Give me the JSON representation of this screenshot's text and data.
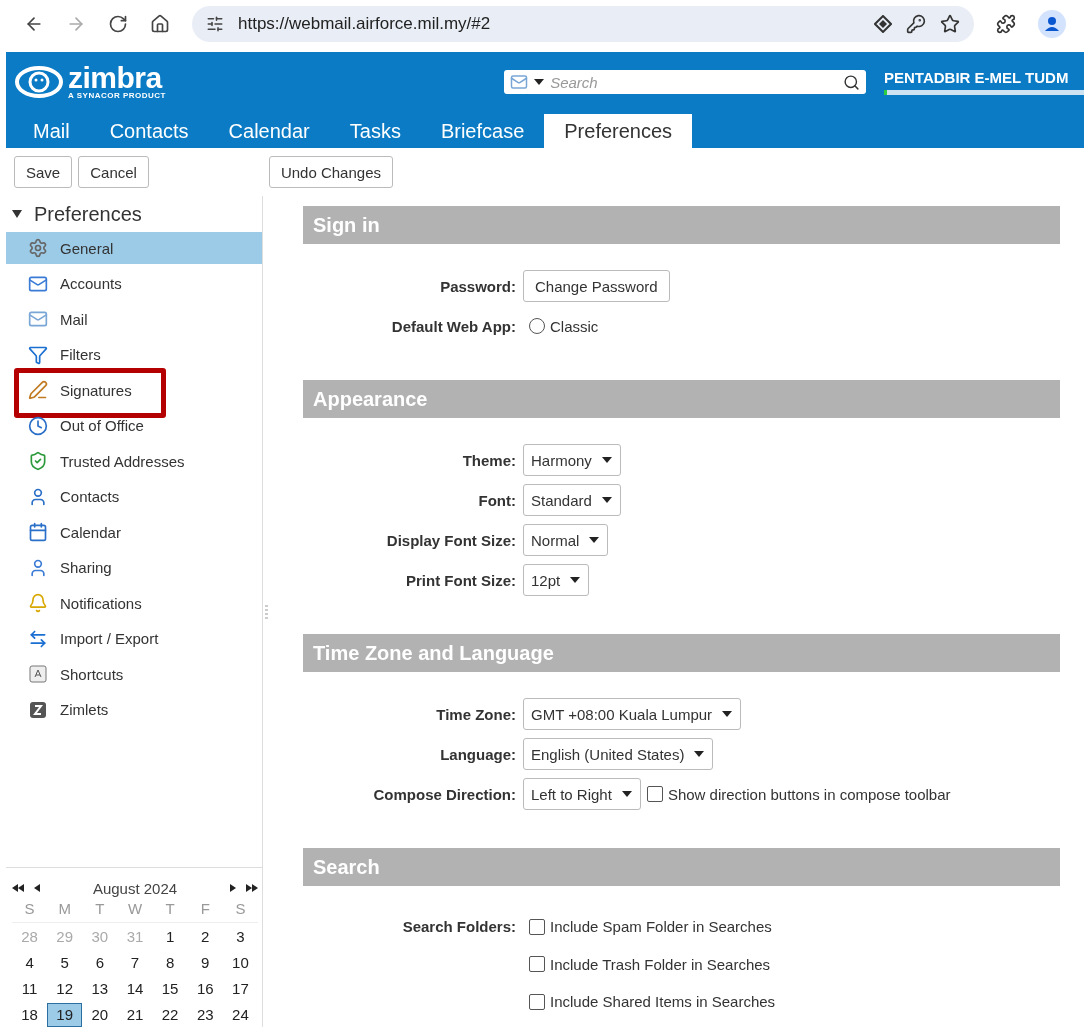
{
  "browser": {
    "url": "https://webmail.airforce.mil.my/#2"
  },
  "header": {
    "logo": "zimbra",
    "logo_tagline": "A SYNACOR PRODUCT",
    "search_placeholder": "Search",
    "user": "PENTADBIR E-MEL TUDM",
    "quota": {
      "level": 0.01
    }
  },
  "app_tabs": [
    {
      "label": "Mail",
      "selected": false
    },
    {
      "label": "Contacts",
      "selected": false
    },
    {
      "label": "Calendar",
      "selected": false
    },
    {
      "label": "Tasks",
      "selected": false
    },
    {
      "label": "Briefcase",
      "selected": false
    },
    {
      "label": "Preferences",
      "selected": true
    }
  ],
  "toolbar": {
    "buttons": [
      "Save",
      "Cancel"
    ],
    "undo": "Undo Changes"
  },
  "sidebar": {
    "title": "Preferences",
    "expanded": true,
    "items": [
      {
        "label": "General",
        "kind": "gear",
        "selected": true,
        "highlighted": false
      },
      {
        "label": "Accounts",
        "kind": "accounts",
        "selected": false,
        "highlighted": false
      },
      {
        "label": "Mail",
        "kind": "mail",
        "selected": false,
        "highlighted": false
      },
      {
        "label": "Filters",
        "kind": "filter",
        "selected": false,
        "highlighted": false
      },
      {
        "label": "Signatures",
        "kind": "signature",
        "selected": false,
        "highlighted": true
      },
      {
        "label": "Out of Office",
        "kind": "clock",
        "selected": false,
        "highlighted": false
      },
      {
        "label": "Trusted Addresses",
        "kind": "shield",
        "selected": false,
        "highlighted": false
      },
      {
        "label": "Contacts",
        "kind": "person",
        "selected": false,
        "highlighted": false
      },
      {
        "label": "Calendar",
        "kind": "calendar",
        "selected": false,
        "highlighted": false
      },
      {
        "label": "Sharing",
        "kind": "sharing",
        "selected": false,
        "highlighted": false
      },
      {
        "label": "Notifications",
        "kind": "bell",
        "selected": false,
        "highlighted": false
      },
      {
        "label": "Import / Export",
        "kind": "arrows",
        "selected": false,
        "highlighted": false
      },
      {
        "label": "Shortcuts",
        "kind": "key",
        "selected": false,
        "highlighted": false
      },
      {
        "label": "Zimlets",
        "kind": "zimlet",
        "selected": false,
        "highlighted": false
      }
    ]
  },
  "mini_calendar": {
    "month": "August 2024",
    "weekdays": [
      "S",
      "M",
      "T",
      "W",
      "T",
      "F",
      "S"
    ],
    "weeks": [
      [
        {
          "day": "28",
          "muted": true,
          "selected": false
        },
        {
          "day": "29",
          "muted": true,
          "selected": false
        },
        {
          "day": "30",
          "muted": true,
          "selected": false
        },
        {
          "day": "31",
          "muted": true,
          "selected": false
        },
        {
          "day": "1",
          "muted": false,
          "selected": false
        },
        {
          "day": "2",
          "muted": false,
          "selected": false
        },
        {
          "day": "3",
          "muted": false,
          "selected": false
        }
      ],
      [
        {
          "day": "4",
          "muted": false,
          "selected": false
        },
        {
          "day": "5",
          "muted": false,
          "selected": false
        },
        {
          "day": "6",
          "muted": false,
          "selected": false
        },
        {
          "day": "7",
          "muted": false,
          "selected": false
        },
        {
          "day": "8",
          "muted": false,
          "selected": false
        },
        {
          "day": "9",
          "muted": false,
          "selected": false
        },
        {
          "day": "10",
          "muted": false,
          "selected": false
        }
      ],
      [
        {
          "day": "11",
          "muted": false,
          "selected": false
        },
        {
          "day": "12",
          "muted": false,
          "selected": false
        },
        {
          "day": "13",
          "muted": false,
          "selected": false
        },
        {
          "day": "14",
          "muted": false,
          "selected": false
        },
        {
          "day": "15",
          "muted": false,
          "selected": false
        },
        {
          "day": "16",
          "muted": false,
          "selected": false
        },
        {
          "day": "17",
          "muted": false,
          "selected": false
        }
      ],
      [
        {
          "day": "18",
          "muted": false,
          "selected": false
        },
        {
          "day": "19",
          "muted": false,
          "selected": true
        },
        {
          "day": "20",
          "muted": false,
          "selected": false
        },
        {
          "day": "21",
          "muted": false,
          "selected": false
        },
        {
          "day": "22",
          "muted": false,
          "selected": false
        },
        {
          "day": "23",
          "muted": false,
          "selected": false
        },
        {
          "day": "24",
          "muted": false,
          "selected": false
        }
      ]
    ]
  },
  "sections": [
    {
      "title": "Sign in",
      "rows": [
        {
          "label": "Password:",
          "controls": [
            {
              "kind": "button",
              "text": "Change Password"
            }
          ]
        },
        {
          "label": "Default Web App:",
          "controls": [
            {
              "kind": "radio",
              "text": "Classic",
              "checked": false
            }
          ]
        }
      ]
    },
    {
      "title": "Appearance",
      "rows": [
        {
          "label": "Theme:",
          "controls": [
            {
              "kind": "select",
              "text": "Harmony"
            }
          ]
        },
        {
          "label": "Font:",
          "controls": [
            {
              "kind": "select",
              "text": "Standard"
            }
          ]
        },
        {
          "label": "Display Font Size:",
          "controls": [
            {
              "kind": "select",
              "text": "Normal"
            }
          ]
        },
        {
          "label": "Print Font Size:",
          "controls": [
            {
              "kind": "select",
              "text": "12pt"
            }
          ]
        }
      ]
    },
    {
      "title": "Time Zone and Language",
      "rows": [
        {
          "label": "Time Zone:",
          "controls": [
            {
              "kind": "select",
              "text": "GMT +08:00 Kuala Lumpur"
            }
          ]
        },
        {
          "label": "Language:",
          "controls": [
            {
              "kind": "select",
              "text": "English (United States)"
            }
          ]
        },
        {
          "label": "Compose Direction:",
          "controls": [
            {
              "kind": "select",
              "text": "Left to Right"
            },
            {
              "kind": "checkbox",
              "text": "Show direction buttons in compose toolbar",
              "checked": false
            }
          ]
        }
      ]
    },
    {
      "title": "Search",
      "rows": [
        {
          "label": "Search Folders:",
          "controls": [
            {
              "kind": "checkbox",
              "text": "Include Spam Folder in Searches",
              "checked": false
            }
          ]
        },
        {
          "controls": [
            {
              "kind": "checkbox",
              "text": "Include Trash Folder in Searches",
              "checked": false
            }
          ]
        },
        {
          "controls": [
            {
              "kind": "checkbox",
              "text": "Include Shared Items in Searches",
              "checked": false
            }
          ]
        }
      ]
    }
  ]
}
